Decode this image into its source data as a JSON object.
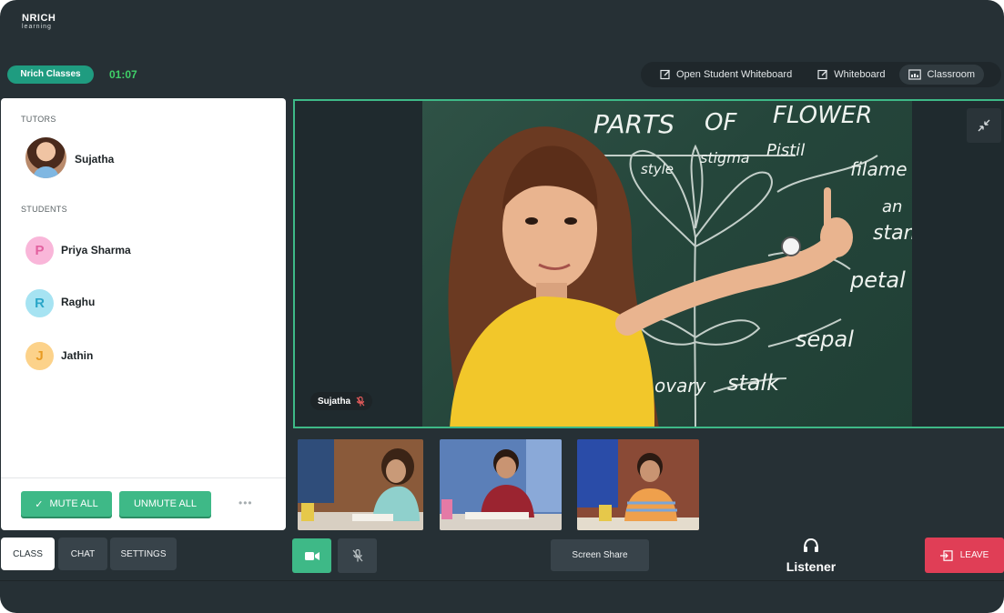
{
  "brand": {
    "name": "NRICH",
    "sub": "learning"
  },
  "header": {
    "class_label": "Nrich Classes",
    "timer": "01:07",
    "view_tabs": [
      {
        "label": "Open Student Whiteboard",
        "icon": "edit-icon"
      },
      {
        "label": "Whiteboard",
        "icon": "edit-icon"
      },
      {
        "label": "Classroom",
        "icon": "classroom-icon"
      }
    ]
  },
  "participants": {
    "tutors_label": "TUTORS",
    "tutor": {
      "name": "Sujatha"
    },
    "students_label": "STUDENTS",
    "students": [
      {
        "initial": "P",
        "name": "Priya Sharma",
        "bg": "#f9b6d9",
        "fg": "#e2609f"
      },
      {
        "initial": "R",
        "name": "Raghu",
        "bg": "#a6e3f2",
        "fg": "#2aa6c8"
      },
      {
        "initial": "J",
        "name": "Jathin",
        "bg": "#fcd28a",
        "fg": "#e89b23"
      }
    ],
    "mute_all_label": "MUTE ALL",
    "unmute_all_label": "UNMUTE ALL",
    "more_label": "•••"
  },
  "bottom_tabs": {
    "class": "CLASS",
    "chat": "CHAT",
    "settings": "SETTINGS"
  },
  "main_video": {
    "speaker_name": "Sujatha",
    "board_texts": [
      "PARTS",
      "OF",
      "FLOWER",
      "style",
      "stigma",
      "Pistil",
      "filament",
      "an",
      "stam",
      "petal",
      "sepal",
      "ovary",
      "stalk"
    ]
  },
  "controls": {
    "screen_share_label": "Screen Share",
    "listener_label": "Listener",
    "leave_label": "LEAVE"
  },
  "colors": {
    "accent_green": "#3eb987",
    "timer_green": "#3fd068",
    "leave_red": "#e03e56",
    "background": "#263035"
  }
}
